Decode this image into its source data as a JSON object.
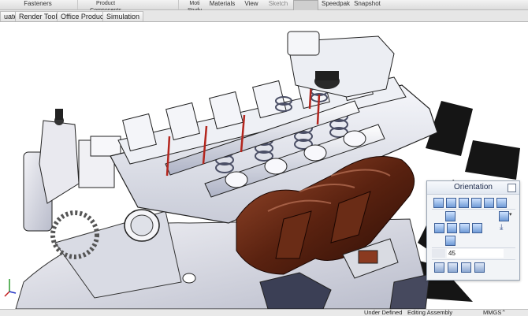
{
  "ribbon": {
    "captions": [
      "Fasteners",
      "Product\nComponents",
      "Moti\nStudy",
      "Materials",
      "View",
      "Sketch",
      "Speedpak",
      "Snapshot"
    ]
  },
  "tabs": [
    "uate",
    "Render Tools",
    "Office Products",
    "Simulation"
  ],
  "orientation_panel": {
    "title": "Orientation",
    "angle_value": "45"
  },
  "status": {
    "state": "Under Defined",
    "mode": "Editing Assembly",
    "units": "MMGS"
  },
  "colors": {
    "manifold": "#4a1c0d",
    "head": "#e9eaf0",
    "background": "#ffffff",
    "accent": "#2f4b8a"
  }
}
